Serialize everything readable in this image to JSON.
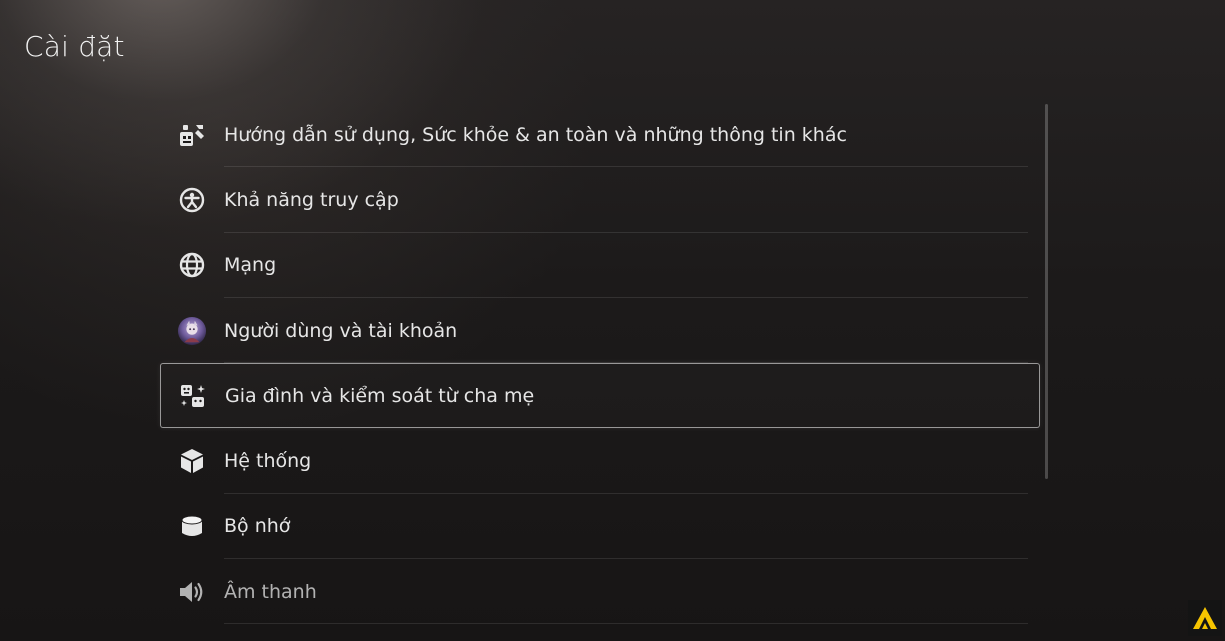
{
  "page": {
    "title": "Cài đặt"
  },
  "menu": {
    "items": [
      {
        "label": "Hướng dẫn sử dụng, Sức khỏe & an toàn và những thông tin khác",
        "icon": "user-guide-icon"
      },
      {
        "label": "Khả năng truy cập",
        "icon": "accessibility-icon"
      },
      {
        "label": "Mạng",
        "icon": "globe-icon"
      },
      {
        "label": "Người dùng và tài khoản",
        "icon": "user-avatar-icon"
      },
      {
        "label": "Gia đình và kiểm soát từ cha mẹ",
        "icon": "family-icon",
        "selected": true
      },
      {
        "label": "Hệ thống",
        "icon": "cube-icon"
      },
      {
        "label": "Bộ nhớ",
        "icon": "storage-cylinder-icon"
      },
      {
        "label": "Âm thanh",
        "icon": "speaker-icon"
      }
    ]
  },
  "colors": {
    "accent_logo": "#f5c400",
    "text": "#e6e6e6",
    "background": "#1c1a1a"
  }
}
